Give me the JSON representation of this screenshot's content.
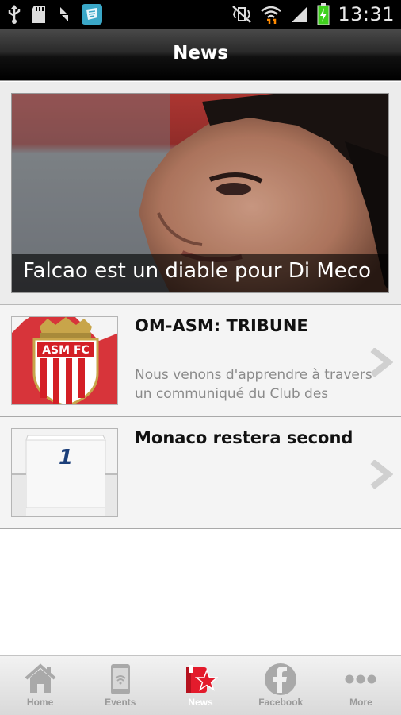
{
  "status_bar": {
    "time": "13:31",
    "icons": [
      "usb-icon",
      "sd-card-icon",
      "sync-icon",
      "app-notification-icon",
      "vibrate-mute-icon",
      "wifi-icon",
      "signal-icon",
      "battery-charging-icon"
    ]
  },
  "header": {
    "title": "News"
  },
  "featured": {
    "title": "Falcao est un diable pour Di Meco"
  },
  "news_items": [
    {
      "title": "OM-ASM: TRIBUNE",
      "summary": "Nous venons d'apprendre à travers un communiqué du Club des",
      "thumb_text": "ASM FC"
    },
    {
      "title": "Monaco restera second",
      "summary": "",
      "thumb_text": "1"
    }
  ],
  "tabs": [
    {
      "label": "Home",
      "icon": "home-icon",
      "active": false
    },
    {
      "label": "Events",
      "icon": "tablet-icon",
      "active": false
    },
    {
      "label": "News",
      "icon": "news-star-icon",
      "active": true
    },
    {
      "label": "Facebook",
      "icon": "facebook-icon",
      "active": false
    },
    {
      "label": "More",
      "icon": "more-dots-icon",
      "active": false
    }
  ],
  "colors": {
    "accent": "#e31b2c",
    "header_bg": "#1a1a1a"
  }
}
